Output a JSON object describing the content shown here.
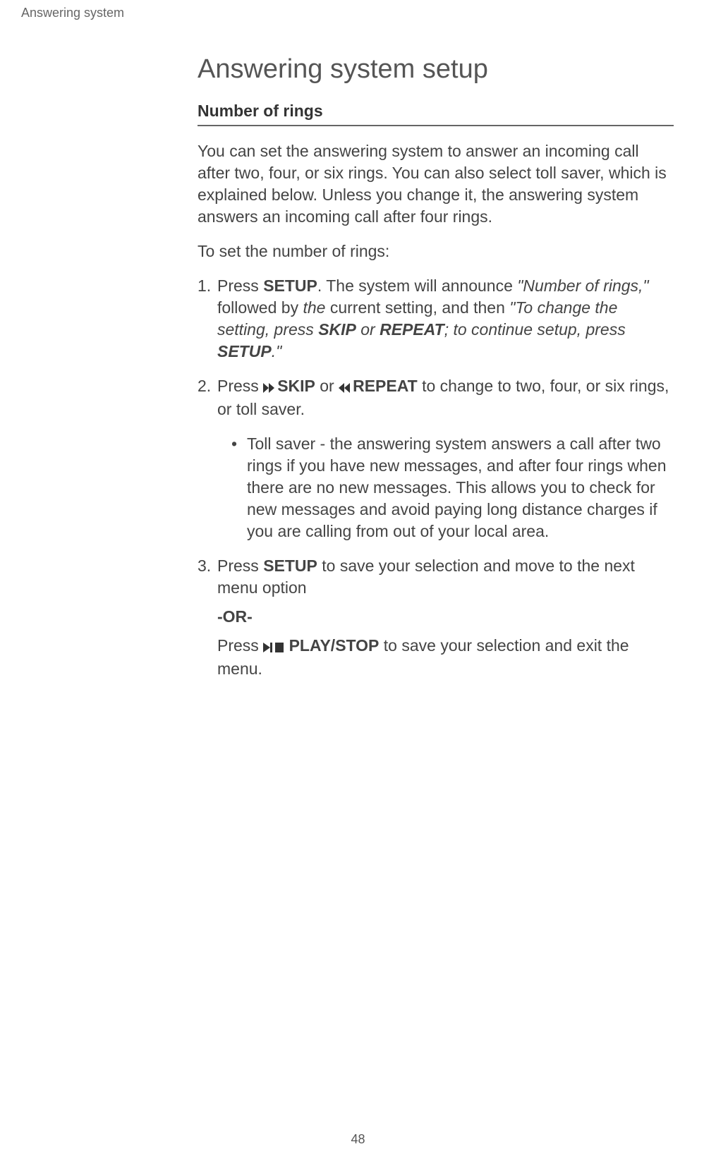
{
  "header": "Answering system",
  "title": "Answering system setup",
  "sectionHeading": "Number of rings",
  "intro": "You can set the answering system to answer an incoming call after two, four, or six rings. You can also select toll saver, which is explained below. Unless you change it, the answering system answers an incoming call after four rings.",
  "lead": "To set the number of rings:",
  "step1_num": "1.",
  "step1_a": "Press ",
  "step1_setup": "SETUP",
  "step1_b": ". The system will announce ",
  "step1_quote1": "\"Number of rings,\"",
  "step1_c": " followed by ",
  "step1_the": "the",
  "step1_d": " current setting, and then ",
  "step1_quote2a": "\"To change the setting, press ",
  "step1_skip": "SKIP",
  "step1_quote2b": " or ",
  "step1_repeat": "REPEAT",
  "step1_quote2c": "; to continue setup, press ",
  "step1_setup2": "SETUP",
  "step1_quote2d": ".\"",
  "step2_num": "2.",
  "step2_a": "Press ",
  "step2_skip": "SKIP",
  "step2_b": " or ",
  "step2_repeat": "REPEAT",
  "step2_c": " to change to two, four, or six rings, or toll saver.",
  "sub_bullet": "•",
  "sub_text": "Toll saver - the answering system answers a call after two rings if you have new messages, and after four rings when there are no new messages. This allows you to check for new messages and avoid paying long distance charges if you are calling from out of your local area.",
  "step3_num": "3.",
  "step3_a": "Press ",
  "step3_setup": "SETUP",
  "step3_b": " to save your selection and move to the next menu option",
  "or_text": "-OR-",
  "step3_c": "Press ",
  "step3_playstop": " PLAY/STOP",
  "step3_d": " to save your selection and exit the menu.",
  "pageNumber": "48"
}
